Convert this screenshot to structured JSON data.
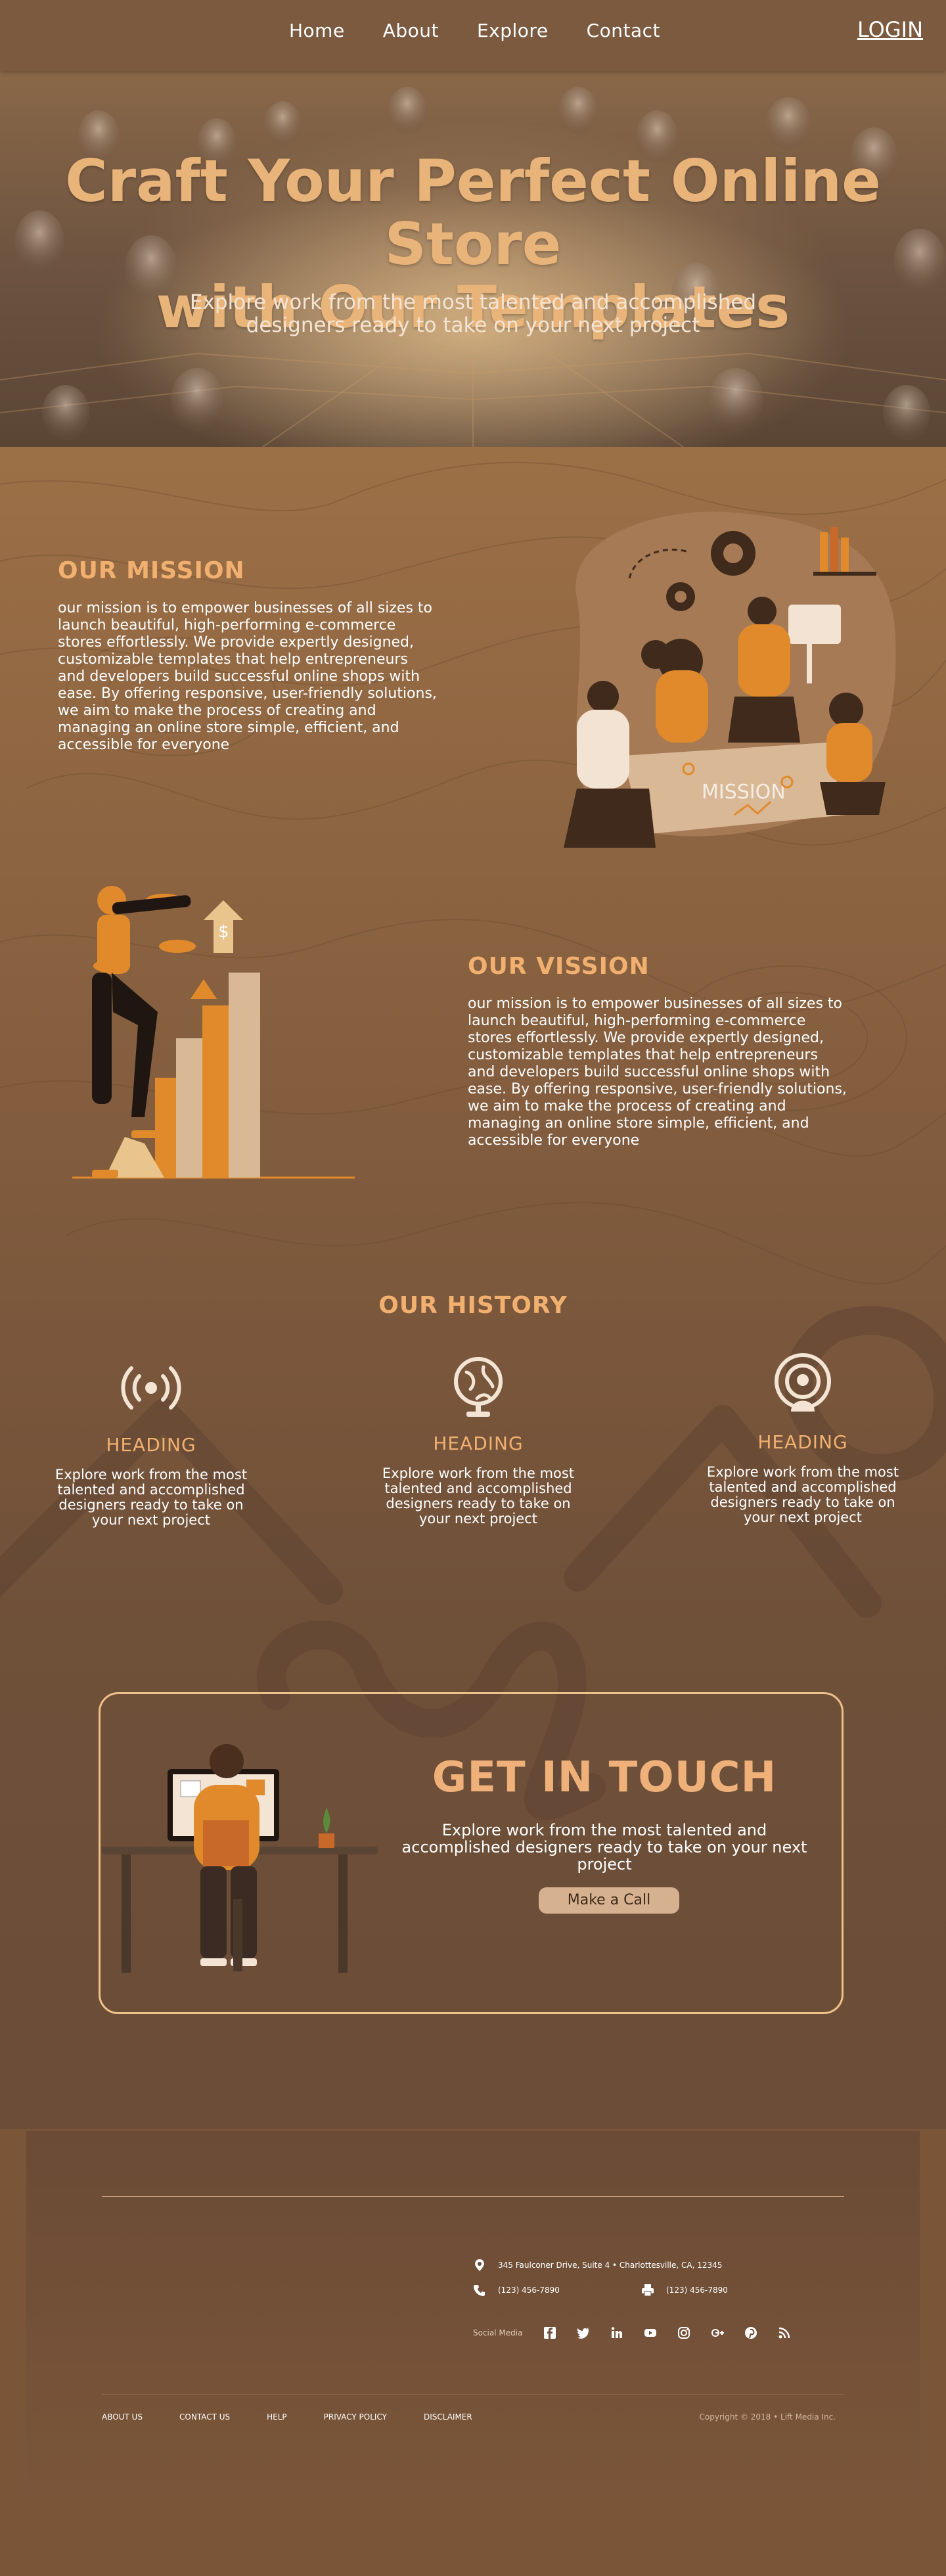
{
  "nav": {
    "links": [
      "Home",
      "About",
      "Explore",
      "Contact"
    ],
    "login": "LOGIN"
  },
  "hero": {
    "title_line1": "Craft Your Perfect Online Store",
    "title_line2": "with Our Templates",
    "subtitle": "Explore work from the most talented and accomplished designers ready to take on your next project"
  },
  "mission": {
    "heading": "OUR MISSION",
    "text": "our mission is to empower businesses of all sizes to launch beautiful, high-performing e-commerce stores effortlessly. We provide expertly designed, customizable templates that help entrepreneurs and developers build successful online shops with ease. By offering responsive, user-friendly solutions, we aim to make the process of creating and managing an online store simple, efficient, and accessible for everyone",
    "illustration_label": "MISSION"
  },
  "vision": {
    "heading": "OUR VISSION",
    "text": "our mission is to empower businesses of all sizes to launch beautiful, high-performing e-commerce stores effortlessly. We provide expertly designed, customizable templates that help entrepreneurs and developers build successful online shops with ease. By offering responsive, user-friendly solutions, we aim to make the process of creating and managing an online store simple, efficient, and accessible for everyone"
  },
  "history": {
    "heading": "OUR HISTORY",
    "items": [
      {
        "icon": "broadcast-icon",
        "heading": "HEADING",
        "text": "Explore work from the most talented and accomplished designers ready to take on your next project"
      },
      {
        "icon": "globe-icon",
        "heading": "HEADING",
        "text": "Explore work from the most talented and accomplished designers ready to take on your next project"
      },
      {
        "icon": "podcast-icon",
        "heading": "HEADING",
        "text": "Explore work from the most talented and accomplished designers ready to take on your next project"
      }
    ]
  },
  "contact": {
    "title": "GET IN TOUCH",
    "subtitle": "Explore work from the most talented and accomplished designers ready to take on your next project",
    "button": "Make a Call"
  },
  "footer": {
    "address": "345 Faulconer Drive, Suite 4 • Charlottesville, CA, 12345",
    "phone": "(123) 456-7890",
    "fax": "(123) 456-7890",
    "social_label": "Social Media",
    "social_icons": [
      "facebook-icon",
      "twitter-icon",
      "linkedin-icon",
      "youtube-icon",
      "instagram-icon",
      "google-plus-icon",
      "pinterest-icon",
      "rss-icon"
    ],
    "links": [
      "ABOUT US",
      "CONTACT US",
      "HELP",
      "PRIVACY POLICY",
      "DISCLAIMER"
    ],
    "copyright": "Copyright © 2018 • Lift Media Inc."
  },
  "colors": {
    "accent": "#f1b070",
    "hero_title": "#e9b47a",
    "nav_bg": "#7b5a3f",
    "button_bg": "#d6b18f",
    "card_border": "#f0c08a"
  }
}
